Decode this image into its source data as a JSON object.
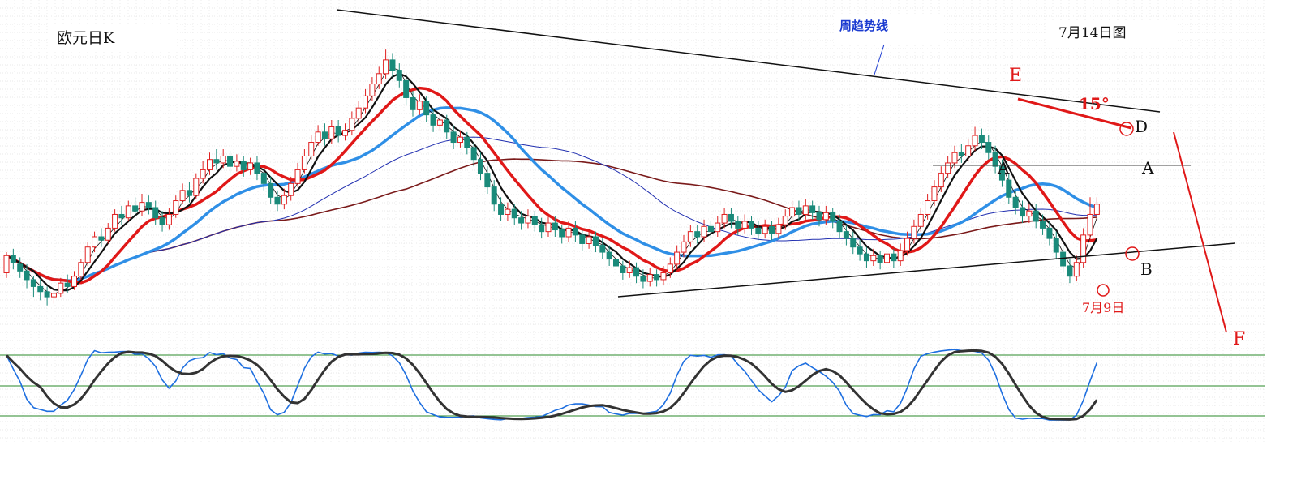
{
  "chart_data": {
    "type": "candlestick",
    "title": "欧元日K",
    "date_label": "7月14日图",
    "trendline_label": "周趋势线",
    "annotations": {
      "E": "E",
      "D": "D",
      "A_left": "A",
      "A_right": "A",
      "B": "B",
      "F": "F",
      "angle": "15°",
      "jul9": "7月9日"
    },
    "colors": {
      "up": "#e02020",
      "down": "#1a8a7a",
      "ma_fast": "#111111",
      "ma_red": "#e01818",
      "ma_blue": "#2f8fe6",
      "ma_slow_blue": "#2230b0",
      "ma_long": "#7a1a1a",
      "trend": "#111111",
      "annot_red": "#e01818",
      "osc_k": "#1e6fe0",
      "osc_d": "#333333",
      "osc_levels": "#2a8a2a"
    },
    "grid": true,
    "candles": [
      [
        1.36,
        1.37,
        1.372,
        1.357
      ],
      [
        1.37,
        1.366,
        1.374,
        1.362
      ],
      [
        1.365,
        1.361,
        1.369,
        1.357
      ],
      [
        1.361,
        1.356,
        1.365,
        1.351
      ],
      [
        1.356,
        1.352,
        1.358,
        1.346
      ],
      [
        1.352,
        1.349,
        1.356,
        1.344
      ],
      [
        1.349,
        1.346,
        1.352,
        1.341
      ],
      [
        1.346,
        1.348,
        1.352,
        1.342
      ],
      [
        1.348,
        1.354,
        1.357,
        1.346
      ],
      [
        1.354,
        1.352,
        1.359,
        1.348
      ],
      [
        1.352,
        1.358,
        1.361,
        1.35
      ],
      [
        1.358,
        1.366,
        1.368,
        1.356
      ],
      [
        1.366,
        1.375,
        1.378,
        1.364
      ],
      [
        1.375,
        1.381,
        1.384,
        1.372
      ],
      [
        1.381,
        1.379,
        1.386,
        1.375
      ],
      [
        1.379,
        1.386,
        1.389,
        1.377
      ],
      [
        1.386,
        1.394,
        1.397,
        1.384
      ],
      [
        1.394,
        1.392,
        1.399,
        1.388
      ],
      [
        1.392,
        1.399,
        1.402,
        1.39
      ],
      [
        1.399,
        1.396,
        1.404,
        1.393
      ],
      [
        1.396,
        1.401,
        1.406,
        1.393
      ],
      [
        1.401,
        1.398,
        1.405,
        1.394
      ],
      [
        1.398,
        1.392,
        1.402,
        1.388
      ],
      [
        1.392,
        1.388,
        1.396,
        1.384
      ],
      [
        1.388,
        1.394,
        1.398,
        1.385
      ],
      [
        1.394,
        1.402,
        1.405,
        1.392
      ],
      [
        1.402,
        1.408,
        1.412,
        1.4
      ],
      [
        1.408,
        1.405,
        1.413,
        1.401
      ],
      [
        1.405,
        1.415,
        1.418,
        1.403
      ],
      [
        1.415,
        1.42,
        1.425,
        1.412
      ],
      [
        1.42,
        1.426,
        1.43,
        1.417
      ],
      [
        1.426,
        1.424,
        1.432,
        1.42
      ],
      [
        1.424,
        1.428,
        1.432,
        1.421
      ],
      [
        1.428,
        1.422,
        1.431,
        1.418
      ],
      [
        1.422,
        1.425,
        1.429,
        1.419
      ],
      [
        1.425,
        1.42,
        1.428,
        1.416
      ],
      [
        1.42,
        1.424,
        1.427,
        1.417
      ],
      [
        1.424,
        1.418,
        1.428,
        1.414
      ],
      [
        1.418,
        1.412,
        1.421,
        1.408
      ],
      [
        1.412,
        1.404,
        1.416,
        1.4
      ],
      [
        1.404,
        1.4,
        1.408,
        1.396
      ],
      [
        1.4,
        1.405,
        1.409,
        1.397
      ],
      [
        1.405,
        1.412,
        1.416,
        1.402
      ],
      [
        1.412,
        1.42,
        1.424,
        1.41
      ],
      [
        1.42,
        1.428,
        1.432,
        1.418
      ],
      [
        1.428,
        1.436,
        1.44,
        1.426
      ],
      [
        1.436,
        1.442,
        1.446,
        1.434
      ],
      [
        1.442,
        1.438,
        1.447,
        1.434
      ],
      [
        1.438,
        1.445,
        1.449,
        1.435
      ],
      [
        1.445,
        1.44,
        1.449,
        1.436
      ],
      [
        1.44,
        1.443,
        1.447,
        1.437
      ],
      [
        1.443,
        1.45,
        1.454,
        1.44
      ],
      [
        1.45,
        1.456,
        1.46,
        1.447
      ],
      [
        1.456,
        1.463,
        1.467,
        1.453
      ],
      [
        1.463,
        1.47,
        1.474,
        1.46
      ],
      [
        1.47,
        1.476,
        1.48,
        1.467
      ],
      [
        1.476,
        1.484,
        1.49,
        1.473
      ],
      [
        1.484,
        1.478,
        1.488,
        1.474
      ],
      [
        1.478,
        1.472,
        1.482,
        1.468
      ],
      [
        1.472,
        1.462,
        1.476,
        1.458
      ],
      [
        1.462,
        1.455,
        1.466,
        1.451
      ],
      [
        1.455,
        1.46,
        1.464,
        1.452
      ],
      [
        1.46,
        1.452,
        1.463,
        1.448
      ],
      [
        1.452,
        1.446,
        1.456,
        1.442
      ],
      [
        1.446,
        1.449,
        1.453,
        1.443
      ],
      [
        1.449,
        1.442,
        1.452,
        1.438
      ],
      [
        1.442,
        1.436,
        1.446,
        1.432
      ],
      [
        1.436,
        1.439,
        1.443,
        1.433
      ],
      [
        1.439,
        1.433,
        1.442,
        1.429
      ],
      [
        1.433,
        1.426,
        1.436,
        1.422
      ],
      [
        1.426,
        1.418,
        1.43,
        1.414
      ],
      [
        1.418,
        1.41,
        1.422,
        1.406
      ],
      [
        1.41,
        1.4,
        1.414,
        1.396
      ],
      [
        1.4,
        1.394,
        1.404,
        1.39
      ],
      [
        1.394,
        1.397,
        1.401,
        1.39
      ],
      [
        1.397,
        1.392,
        1.4,
        1.388
      ],
      [
        1.392,
        1.389,
        1.396,
        1.385
      ],
      [
        1.389,
        1.393,
        1.397,
        1.386
      ],
      [
        1.393,
        1.388,
        1.396,
        1.384
      ],
      [
        1.388,
        1.384,
        1.392,
        1.38
      ],
      [
        1.384,
        1.389,
        1.393,
        1.381
      ],
      [
        1.389,
        1.385,
        1.393,
        1.381
      ],
      [
        1.385,
        1.381,
        1.388,
        1.377
      ],
      [
        1.381,
        1.386,
        1.39,
        1.378
      ],
      [
        1.386,
        1.382,
        1.39,
        1.378
      ],
      [
        1.382,
        1.377,
        1.385,
        1.373
      ],
      [
        1.377,
        1.381,
        1.385,
        1.374
      ],
      [
        1.381,
        1.376,
        1.384,
        1.372
      ],
      [
        1.376,
        1.372,
        1.38,
        1.368
      ],
      [
        1.372,
        1.368,
        1.376,
        1.364
      ],
      [
        1.368,
        1.364,
        1.372,
        1.36
      ],
      [
        1.364,
        1.36,
        1.367,
        1.356
      ],
      [
        1.36,
        1.363,
        1.367,
        1.357
      ],
      [
        1.363,
        1.358,
        1.366,
        1.354
      ],
      [
        1.358,
        1.355,
        1.362,
        1.351
      ],
      [
        1.355,
        1.359,
        1.363,
        1.352
      ],
      [
        1.359,
        1.356,
        1.362,
        1.352
      ],
      [
        1.356,
        1.36,
        1.364,
        1.353
      ],
      [
        1.36,
        1.365,
        1.369,
        1.357
      ],
      [
        1.365,
        1.372,
        1.376,
        1.362
      ],
      [
        1.372,
        1.378,
        1.382,
        1.369
      ],
      [
        1.378,
        1.384,
        1.388,
        1.375
      ],
      [
        1.384,
        1.381,
        1.388,
        1.377
      ],
      [
        1.381,
        1.387,
        1.391,
        1.378
      ],
      [
        1.387,
        1.384,
        1.39,
        1.38
      ],
      [
        1.384,
        1.389,
        1.393,
        1.381
      ],
      [
        1.389,
        1.394,
        1.398,
        1.386
      ],
      [
        1.394,
        1.39,
        1.398,
        1.386
      ],
      [
        1.39,
        1.386,
        1.393,
        1.382
      ],
      [
        1.386,
        1.39,
        1.394,
        1.383
      ],
      [
        1.39,
        1.386,
        1.393,
        1.382
      ],
      [
        1.386,
        1.383,
        1.39,
        1.379
      ],
      [
        1.383,
        1.387,
        1.391,
        1.38
      ],
      [
        1.387,
        1.383,
        1.39,
        1.379
      ],
      [
        1.383,
        1.388,
        1.392,
        1.38
      ],
      [
        1.388,
        1.393,
        1.397,
        1.385
      ],
      [
        1.393,
        1.398,
        1.402,
        1.39
      ],
      [
        1.398,
        1.394,
        1.402,
        1.39
      ],
      [
        1.394,
        1.399,
        1.403,
        1.391
      ],
      [
        1.399,
        1.395,
        1.402,
        1.391
      ],
      [
        1.395,
        1.391,
        1.399,
        1.387
      ],
      [
        1.391,
        1.395,
        1.399,
        1.388
      ],
      [
        1.395,
        1.39,
        1.398,
        1.386
      ],
      [
        1.39,
        1.384,
        1.394,
        1.38
      ],
      [
        1.384,
        1.38,
        1.388,
        1.376
      ],
      [
        1.38,
        1.375,
        1.384,
        1.371
      ],
      [
        1.375,
        1.371,
        1.379,
        1.367
      ],
      [
        1.371,
        1.367,
        1.375,
        1.363
      ],
      [
        1.367,
        1.37,
        1.374,
        1.364
      ],
      [
        1.37,
        1.366,
        1.373,
        1.362
      ],
      [
        1.366,
        1.371,
        1.375,
        1.363
      ],
      [
        1.371,
        1.367,
        1.374,
        1.363
      ],
      [
        1.367,
        1.373,
        1.377,
        1.364
      ],
      [
        1.373,
        1.38,
        1.384,
        1.37
      ],
      [
        1.38,
        1.387,
        1.391,
        1.377
      ],
      [
        1.387,
        1.394,
        1.398,
        1.384
      ],
      [
        1.394,
        1.402,
        1.406,
        1.391
      ],
      [
        1.402,
        1.41,
        1.414,
        1.399
      ],
      [
        1.41,
        1.418,
        1.422,
        1.407
      ],
      [
        1.418,
        1.424,
        1.428,
        1.415
      ],
      [
        1.424,
        1.43,
        1.434,
        1.421
      ],
      [
        1.43,
        1.428,
        1.435,
        1.424
      ],
      [
        1.428,
        1.434,
        1.438,
        1.425
      ],
      [
        1.434,
        1.44,
        1.445,
        1.431
      ],
      [
        1.44,
        1.436,
        1.444,
        1.432
      ],
      [
        1.436,
        1.43,
        1.44,
        1.426
      ],
      [
        1.43,
        1.422,
        1.434,
        1.418
      ],
      [
        1.422,
        1.414,
        1.426,
        1.41
      ],
      [
        1.414,
        1.404,
        1.418,
        1.4
      ],
      [
        1.404,
        1.398,
        1.408,
        1.394
      ],
      [
        1.398,
        1.393,
        1.402,
        1.389
      ],
      [
        1.393,
        1.396,
        1.4,
        1.389
      ],
      [
        1.396,
        1.39,
        1.4,
        1.386
      ],
      [
        1.39,
        1.386,
        1.394,
        1.382
      ],
      [
        1.386,
        1.38,
        1.39,
        1.376
      ],
      [
        1.38,
        1.372,
        1.384,
        1.368
      ],
      [
        1.372,
        1.364,
        1.376,
        1.36
      ],
      [
        1.364,
        1.358,
        1.368,
        1.354
      ],
      [
        1.358,
        1.366,
        1.37,
        1.355
      ],
      [
        1.366,
        1.382,
        1.386,
        1.363
      ],
      [
        1.382,
        1.394,
        1.404,
        1.379
      ],
      [
        1.394,
        1.4,
        1.404,
        1.39
      ]
    ]
  }
}
